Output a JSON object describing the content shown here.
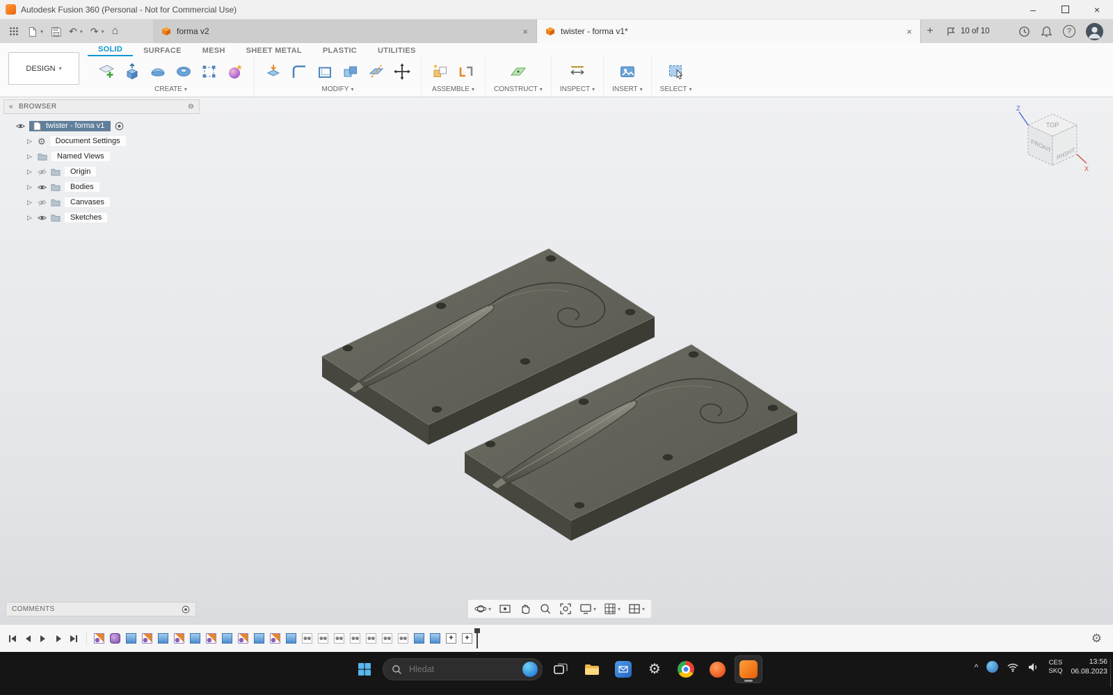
{
  "titlebar": {
    "title": "Autodesk Fusion 360 (Personal - Not for Commercial Use)",
    "minimize": "–",
    "close": "×"
  },
  "glyphs": {
    "caret": "▾",
    "expand": "▷",
    "collapse": "«",
    "circle_minus": "⊖",
    "gear": "⚙",
    "close": "×",
    "plus": "+",
    "undo": "↶",
    "redo": "↷",
    "home": "⌂",
    "help": "?",
    "chevron_up": "^"
  },
  "doc_tabs": {
    "tabs": [
      {
        "label": "forma v2"
      },
      {
        "label": "twister - forma v1*"
      }
    ],
    "job_status": "10 of 10"
  },
  "ribbon": {
    "workspace": "DESIGN",
    "tabs": [
      {
        "label": "SOLID"
      },
      {
        "label": "SURFACE"
      },
      {
        "label": "MESH"
      },
      {
        "label": "SHEET METAL"
      },
      {
        "label": "PLASTIC"
      },
      {
        "label": "UTILITIES"
      }
    ],
    "groups": [
      {
        "label": "CREATE"
      },
      {
        "label": "MODIFY"
      },
      {
        "label": "ASSEMBLE"
      },
      {
        "label": "CONSTRUCT"
      },
      {
        "label": "INSPECT"
      },
      {
        "label": "INSERT"
      },
      {
        "label": "SELECT"
      }
    ]
  },
  "browser": {
    "header": "BROWSER",
    "root_label": "twister - forma v1",
    "items": [
      {
        "label": "Document Settings",
        "icon": "gear",
        "eye": "none"
      },
      {
        "label": "Named Views",
        "icon": "folder",
        "eye": "none"
      },
      {
        "label": "Origin",
        "icon": "folder",
        "eye": "off"
      },
      {
        "label": "Bodies",
        "icon": "folder",
        "eye": "on"
      },
      {
        "label": "Canvases",
        "icon": "folder",
        "eye": "off"
      },
      {
        "label": "Sketches",
        "icon": "folder",
        "eye": "on"
      }
    ]
  },
  "viewcube": {
    "top": "TOP",
    "front": "FRONT",
    "right": "RIGHT",
    "axis_z": "Z",
    "axis_x": "X"
  },
  "comments": {
    "label": "COMMENTS"
  },
  "timeline": {
    "items": [
      "sketch",
      "form",
      "extrude",
      "sketch",
      "extrude",
      "sketch",
      "extrude",
      "sketch",
      "extrude",
      "sketch",
      "extrude",
      "sketch",
      "extrude",
      "hole",
      "hole",
      "hole",
      "hole",
      "hole",
      "hole",
      "hole",
      "extrude",
      "extrude",
      "move",
      "move"
    ]
  },
  "taskbar": {
    "search_placeholder": "Hledat",
    "language_line1": "CES",
    "language_line2": "SKQ",
    "time": "13:56",
    "date": "06.08.2023"
  },
  "colors": {
    "accent_blue": "#0a96d4",
    "selection_blue": "#607f9b",
    "fusion_orange": "#f6891f",
    "plate_top": "#62625a"
  }
}
